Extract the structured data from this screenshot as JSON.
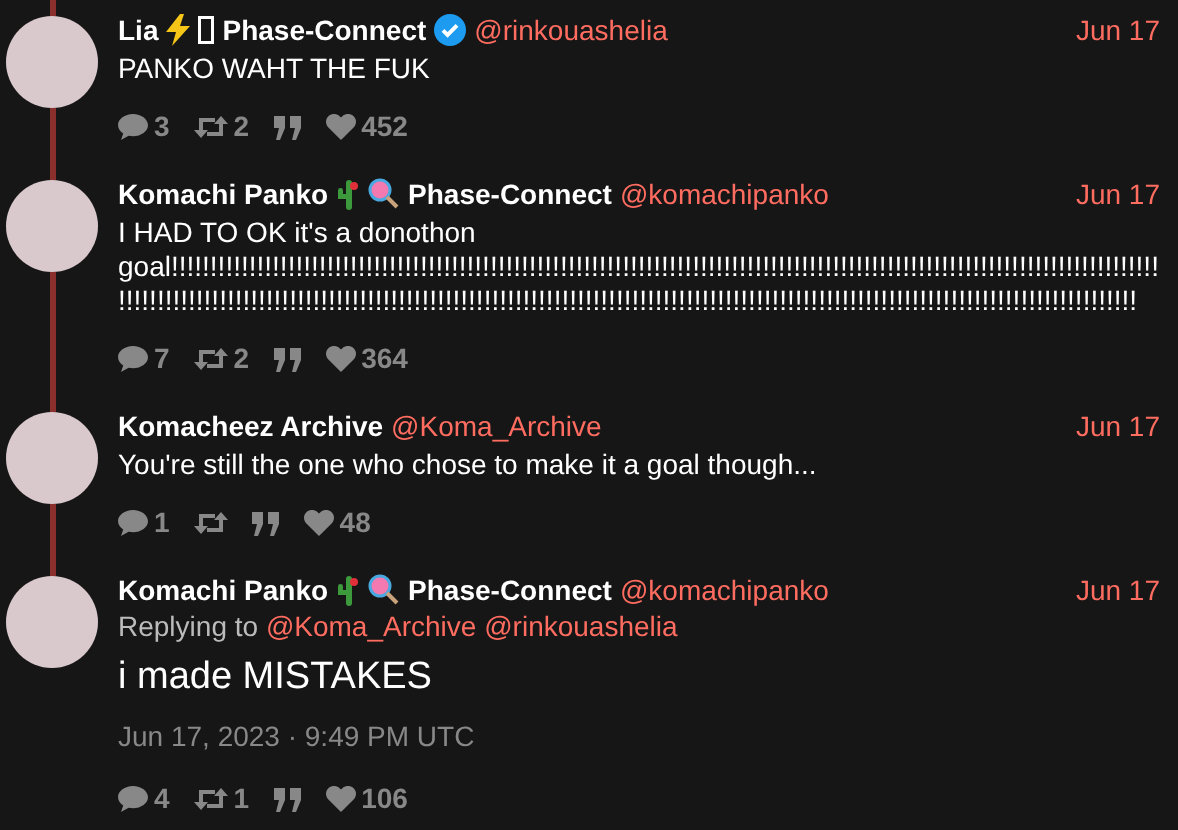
{
  "thread": [
    {
      "name": "Lia",
      "badges": [
        {
          "kind": "bolt"
        },
        {
          "kind": "glyph"
        }
      ],
      "org": "Phase-Connect",
      "verified": true,
      "handle": "@rinkouashelia",
      "date": "Jun 17",
      "text": "PANKO WAHT THE FUK",
      "main": false,
      "stats": [
        {
          "kind": "reply",
          "count": "3"
        },
        {
          "kind": "retweet",
          "count": "2"
        },
        {
          "kind": "quote"
        },
        {
          "kind": "like",
          "count": "452"
        }
      ]
    },
    {
      "name": "Komachi Panko",
      "badges": [
        {
          "kind": "cactus"
        },
        {
          "kind": "lollipop"
        }
      ],
      "org": "Phase-Connect",
      "verified": false,
      "handle": "@komachipanko",
      "date": "Jun 17",
      "text": "I HAD TO OK it's a donothon goal!!!!!!!!!!!!!!!!!!!!!!!!!!!!!!!!!!!!!!!!!!!!!!!!!!!!!!!!!!!!!!!!!!!!!!!!!!!!!!!!!!!!!!!!!!!!!!!!!!!!!!!!!!!!!!!!!!!!!!!!!!!!!!!!!!!!!!!!!!!!!!!!!!!!!!!!!!!!!!!!!!!!!!!!!!!!!!!!!!!!!!!!!!!!!!!!!!!!!!!!!!!!!!!!!!!!!!!!!!!!!!!!!!!!!!!!!!!!!!!!!!!!!!!!!!!!!!!!!!",
      "main": false,
      "stats": [
        {
          "kind": "reply",
          "count": "7"
        },
        {
          "kind": "retweet",
          "count": "2"
        },
        {
          "kind": "quote"
        },
        {
          "kind": "like",
          "count": "364"
        }
      ]
    },
    {
      "name": "Komacheez Archive",
      "verified": false,
      "handle": "@Koma_Archive",
      "date": "Jun 17",
      "text": "You're still the one who chose to make it a goal though...",
      "main": false,
      "stats": [
        {
          "kind": "reply",
          "count": "1"
        },
        {
          "kind": "retweet"
        },
        {
          "kind": "quote"
        },
        {
          "kind": "like",
          "count": "48"
        }
      ]
    },
    {
      "name": "Komachi Panko",
      "badges": [
        {
          "kind": "cactus"
        },
        {
          "kind": "lollipop"
        }
      ],
      "org": "Phase-Connect",
      "verified": false,
      "handle": "@komachipanko",
      "date": "Jun 17",
      "replying_label": "Replying to",
      "replying_to": [
        "@Koma_Archive",
        "@rinkouashelia"
      ],
      "text": "i made MISTAKES",
      "timestamp": "Jun 17, 2023 · 9:49 PM UTC",
      "main": true,
      "stats": [
        {
          "kind": "reply",
          "count": "4"
        },
        {
          "kind": "retweet",
          "count": "1"
        },
        {
          "kind": "quote"
        },
        {
          "kind": "like",
          "count": "106"
        }
      ]
    }
  ]
}
